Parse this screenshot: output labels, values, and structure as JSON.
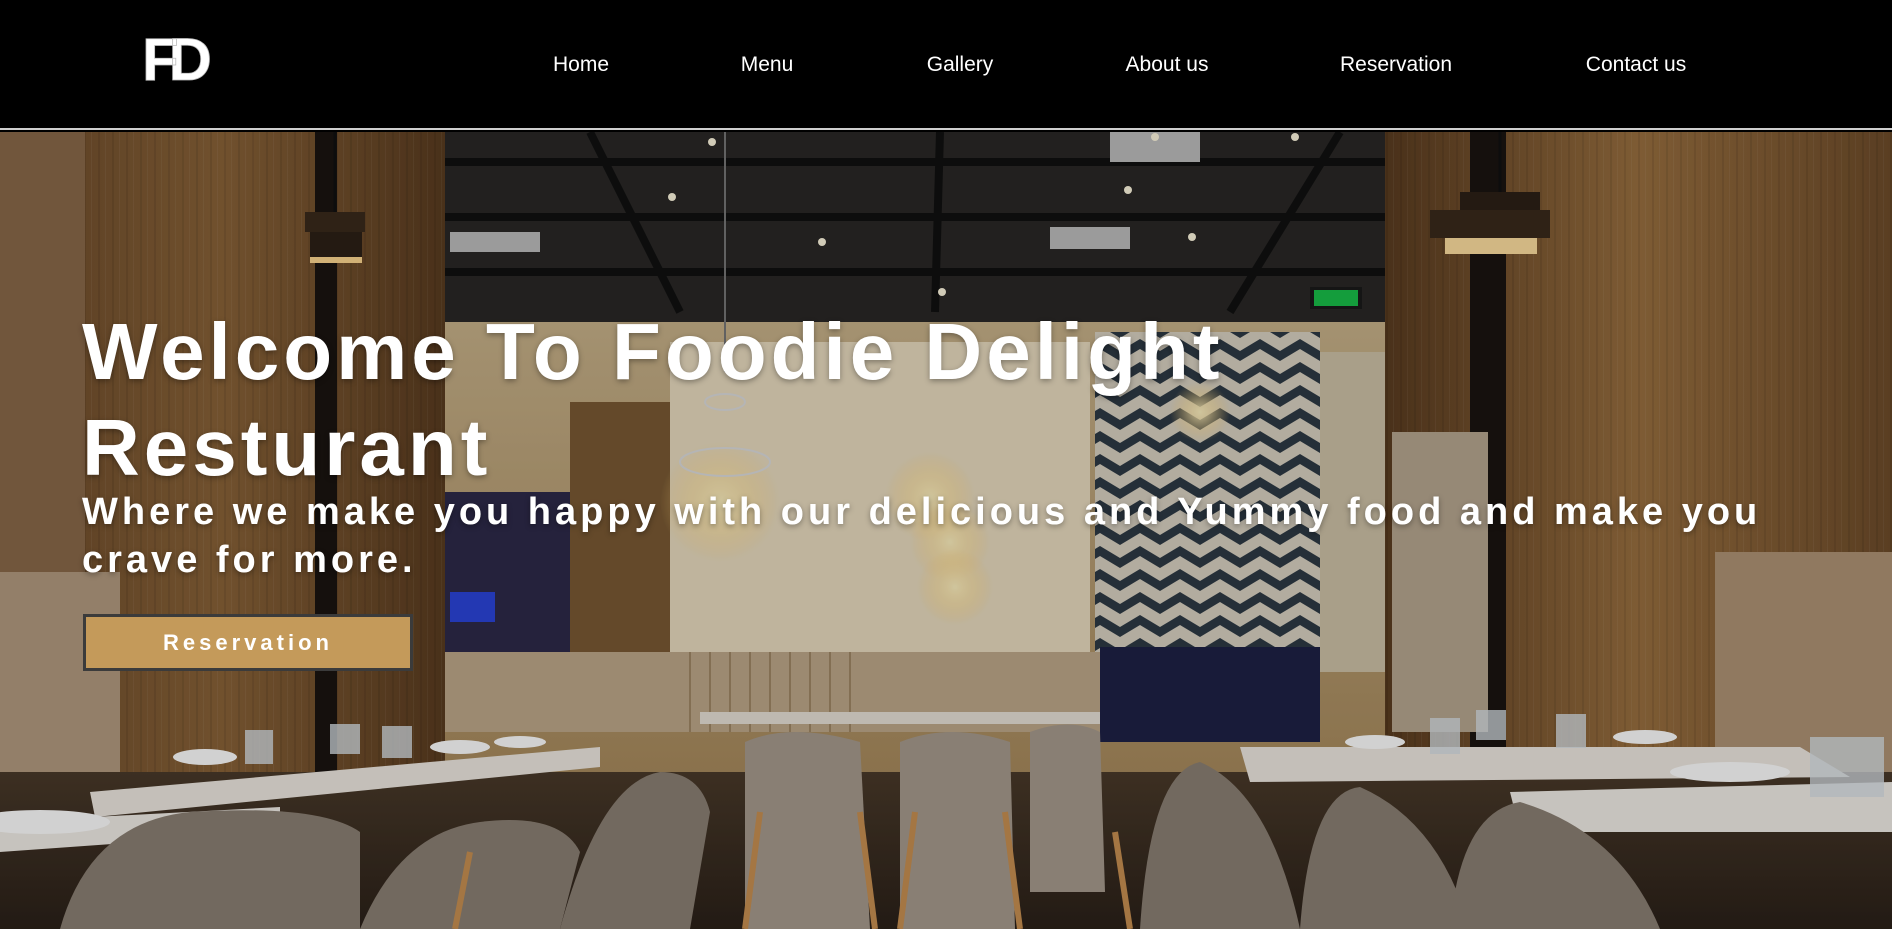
{
  "brand": {
    "logo_text": "FD"
  },
  "nav": {
    "items": [
      {
        "label": "Home"
      },
      {
        "label": "Menu"
      },
      {
        "label": "Gallery"
      },
      {
        "label": "About us"
      },
      {
        "label": "Reservation"
      },
      {
        "label": "Contact us"
      }
    ]
  },
  "hero": {
    "title": "Welcome To Foodie Delight Resturant",
    "subtitle": "Where we make you happy with our delicious and Yummy food and make you crave for more.",
    "cta_label": "Reservation",
    "background": "restaurant-interior-photo"
  },
  "colors": {
    "navbar_bg": "#000000",
    "text": "#ffffff",
    "cta_bg": "#c49a5a",
    "cta_border": "#3b3b3b"
  }
}
